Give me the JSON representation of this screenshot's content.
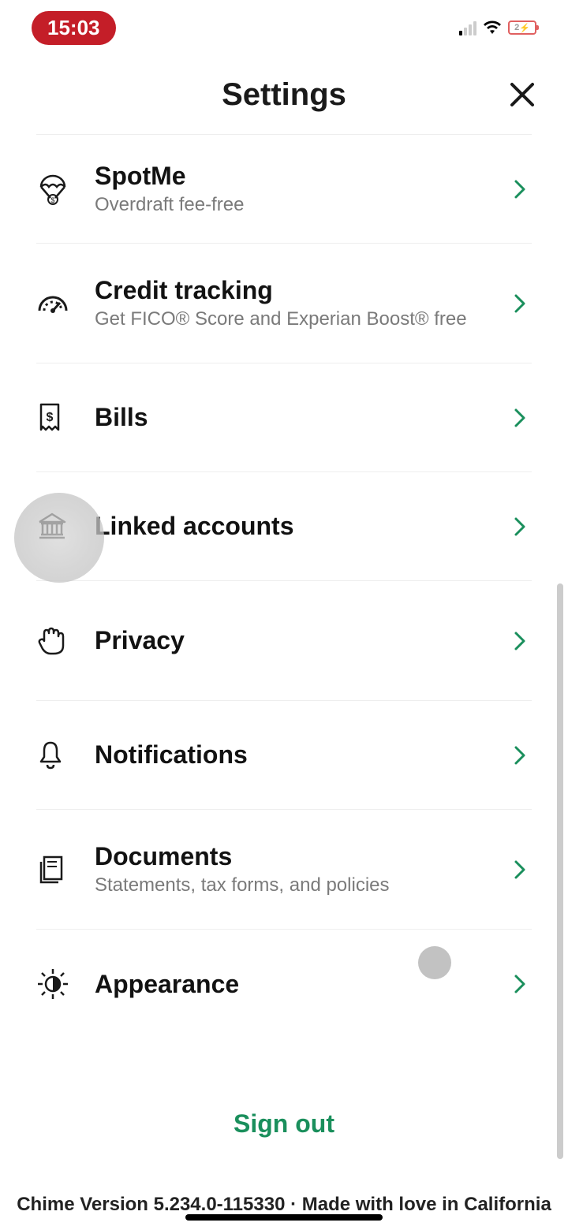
{
  "status": {
    "time": "15:03",
    "battery_label": "2"
  },
  "header": {
    "title": "Settings"
  },
  "rows": [
    {
      "id": "spotme",
      "title": "SpotMe",
      "sub": "Overdraft fee-free"
    },
    {
      "id": "credit",
      "title": "Credit tracking",
      "sub": "Get FICO® Score and Experian Boost® free"
    },
    {
      "id": "bills",
      "title": "Bills",
      "sub": ""
    },
    {
      "id": "linked",
      "title": "Linked accounts",
      "sub": ""
    },
    {
      "id": "privacy",
      "title": "Privacy",
      "sub": ""
    },
    {
      "id": "notifications",
      "title": "Notifications",
      "sub": ""
    },
    {
      "id": "documents",
      "title": "Documents",
      "sub": "Statements, tax forms, and policies"
    },
    {
      "id": "appearance",
      "title": "Appearance",
      "sub": ""
    }
  ],
  "signout": {
    "label": "Sign out"
  },
  "footer": {
    "version": "Chime Version 5.234.0-115330 · Made with love in California"
  },
  "colors": {
    "accent": "#1a8f5c"
  }
}
